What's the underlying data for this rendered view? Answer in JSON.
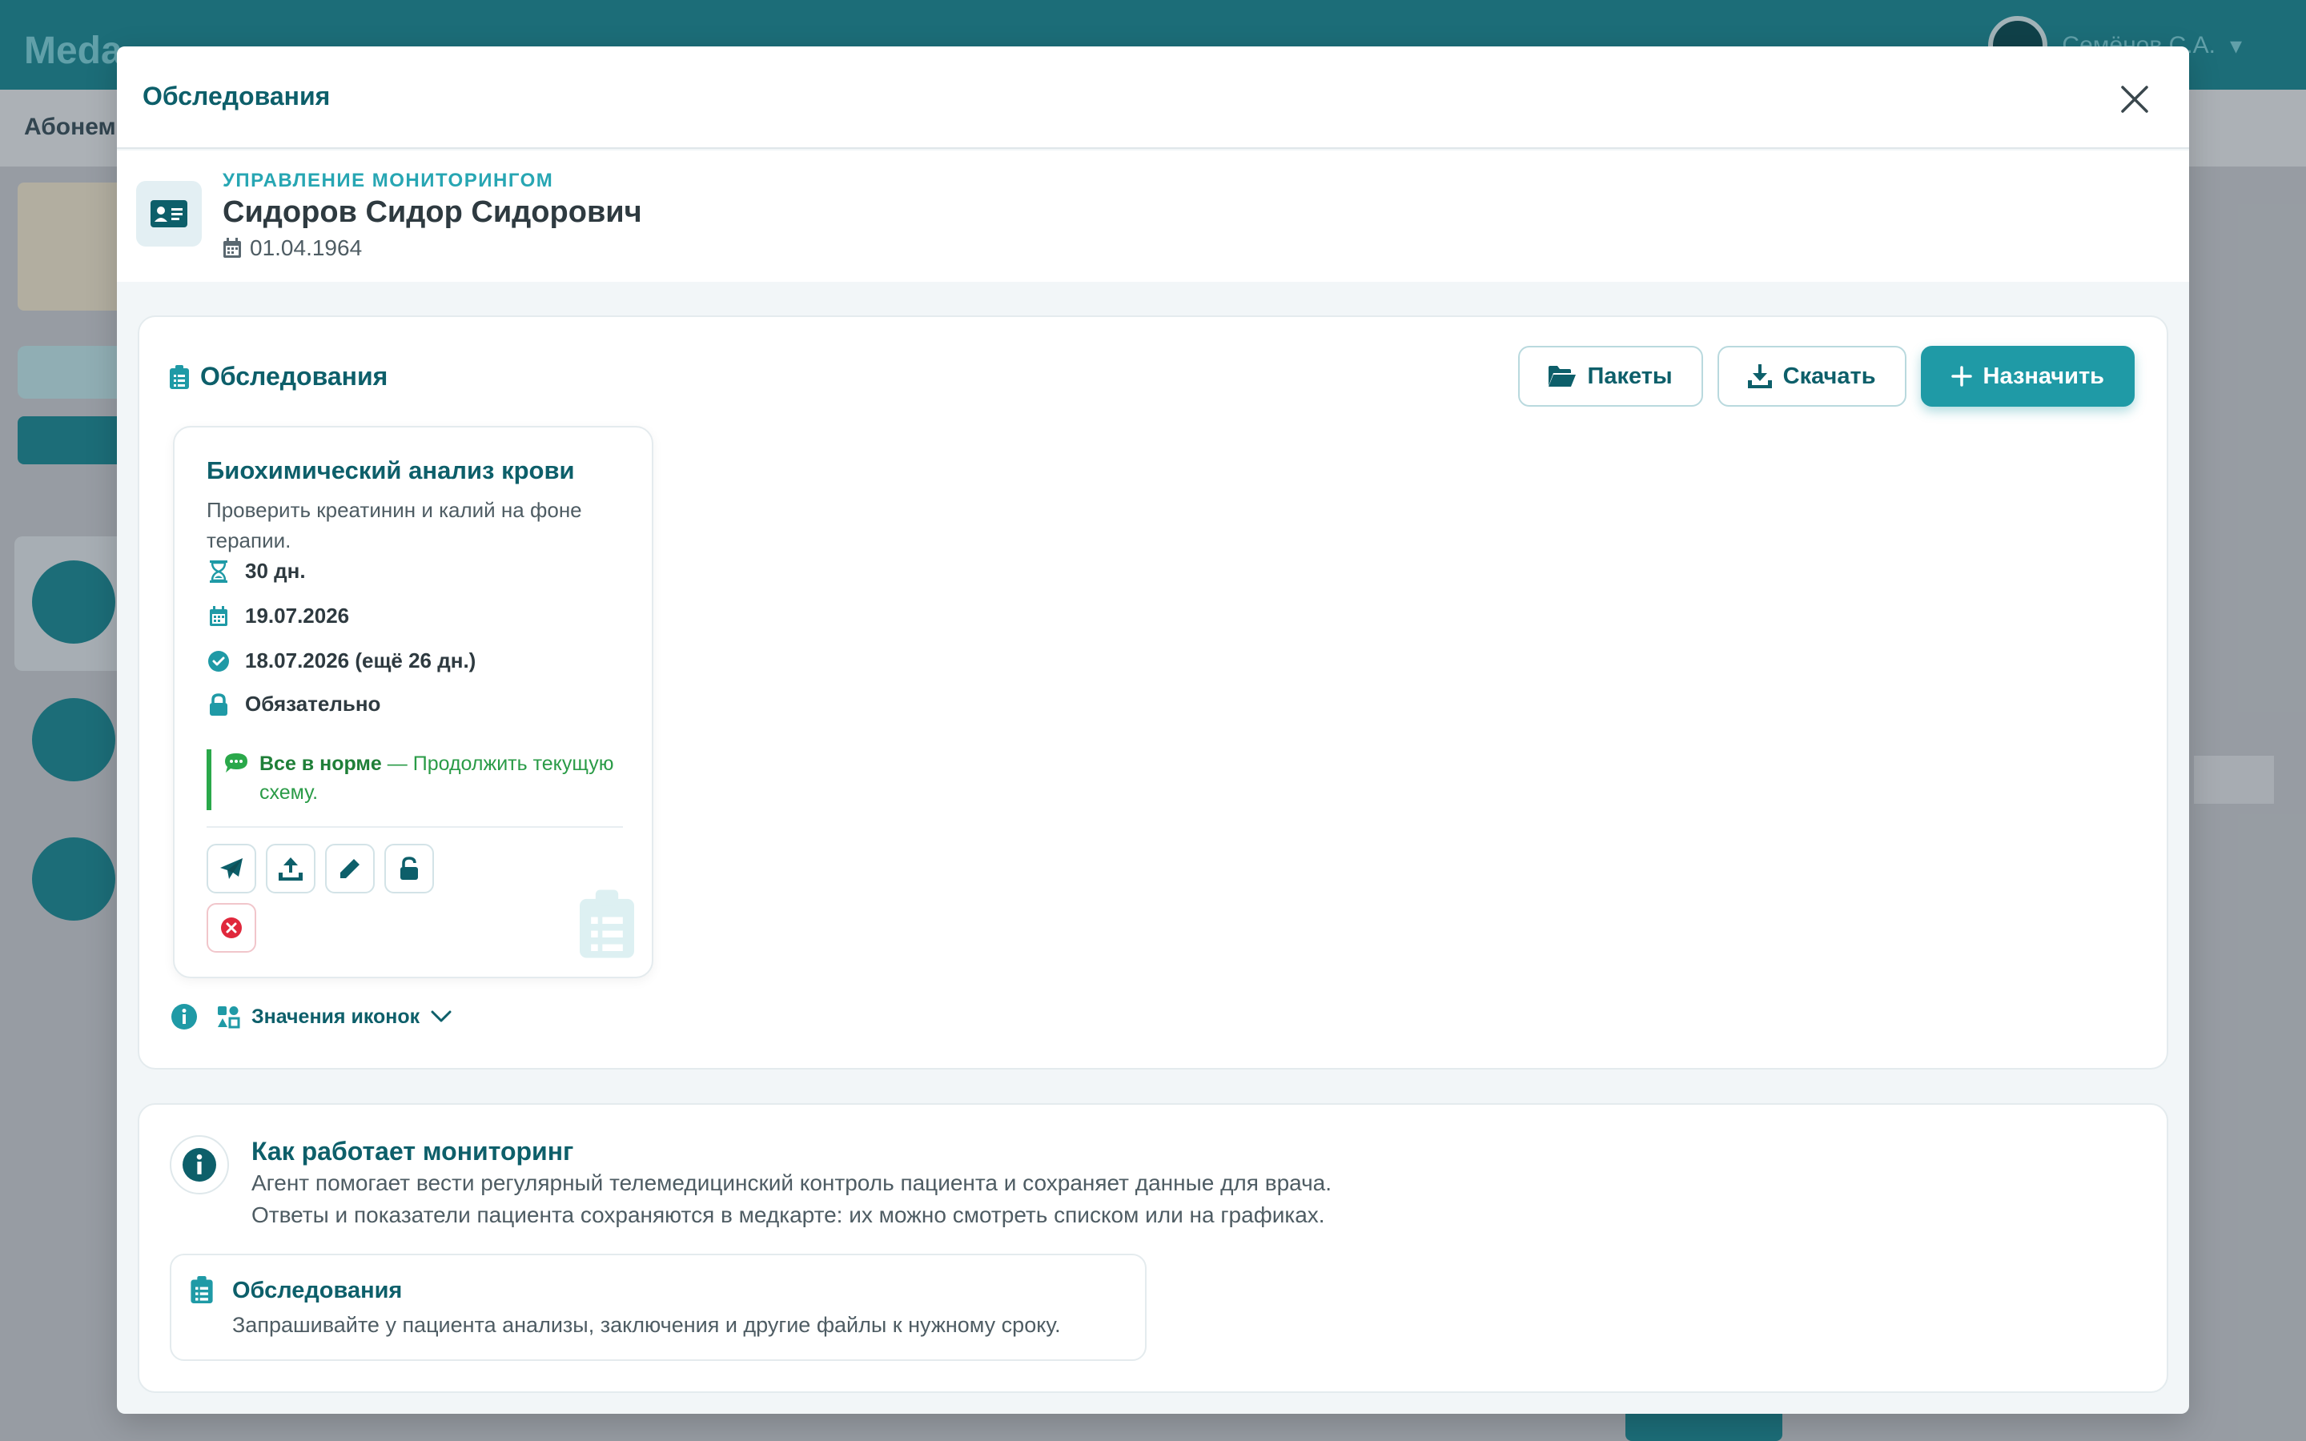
{
  "background": {
    "logo": "Meda",
    "user_name": "Семёнов С.А.",
    "subnav": "Абонем"
  },
  "modal": {
    "title": "Обследования"
  },
  "patient": {
    "kicker": "УПРАВЛЕНИЕ МОНИТОРИНГОМ",
    "name": "Сидоров Сидор Сидорович",
    "dob": "01.04.1964"
  },
  "exams_section": {
    "title": "Обследования",
    "buttons": {
      "packages": "Пакеты",
      "download": "Скачать",
      "assign": "Назначить"
    }
  },
  "exam_card": {
    "title": "Биохимический анализ крови",
    "description": "Проверить креатинин и калий на фоне терапии.",
    "period": "30 дн.",
    "due_date": "19.07.2026",
    "check_date": "18.07.2026 (ещё 26 дн.)",
    "mandatory": "Обязательно",
    "note_bold": "Все в норме",
    "note_text": " — Продолжить текущую схему."
  },
  "legend": {
    "label": "Значения иконок"
  },
  "how_it_works": {
    "title": "Как работает мониторинг",
    "line1": "Агент помогает вести регулярный телемедицинский контроль пациента и сохраняет данные для врача.",
    "line2": "Ответы и показатели пациента сохраняются в медкарте: их можно смотреть списком или на графиках.",
    "feature": {
      "title": "Обследования",
      "description": "Запрашивайте у пациента анализы, заключения и другие файлы к нужному сроку."
    }
  },
  "colors": {
    "accent": "#1f9aa6",
    "heading": "#0d5f6a",
    "success": "#2aa84a",
    "danger": "#e0283c"
  }
}
